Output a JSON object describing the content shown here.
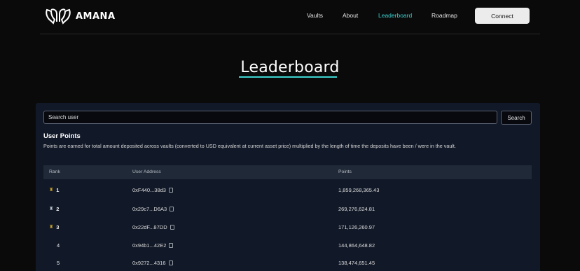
{
  "brand": {
    "name": "AMANA"
  },
  "nav": {
    "items": [
      {
        "label": "Vaults"
      },
      {
        "label": "About"
      },
      {
        "label": "Leaderboard"
      },
      {
        "label": "Roadmap"
      }
    ],
    "active": "Leaderboard",
    "connect_label": "Connect"
  },
  "page": {
    "title": "Leaderboard"
  },
  "search": {
    "placeholder": "Search user",
    "button_label": "Search"
  },
  "points": {
    "title": "User Points",
    "description": "Points are earned for total amount deposited across vaults (converted to USD equivalent at current asset price) multiplied by the length of time the deposits have been / were in the vault."
  },
  "table": {
    "columns": [
      "Rank",
      "User Address",
      "Points"
    ],
    "rows": [
      {
        "rank": "1",
        "trophy": "gold",
        "address": "0xF440...38d3",
        "points": "1,859,268,365.43"
      },
      {
        "rank": "2",
        "trophy": "silver",
        "address": "0x29c7...D6A3",
        "points": "269,276,624.81"
      },
      {
        "rank": "3",
        "trophy": "gold",
        "address": "0x22dF...87DD",
        "points": "171,126,260.97"
      },
      {
        "rank": "4",
        "trophy": "",
        "address": "0x94b1...42E2",
        "points": "144,864,648.82"
      },
      {
        "rank": "5",
        "trophy": "",
        "address": "0x9272...4316",
        "points": "138,474,651.45"
      }
    ]
  },
  "colors": {
    "accent": "#3bd3cf",
    "background": "#0a0a0a",
    "panel": "#111827",
    "table_header": "#1f2937"
  }
}
